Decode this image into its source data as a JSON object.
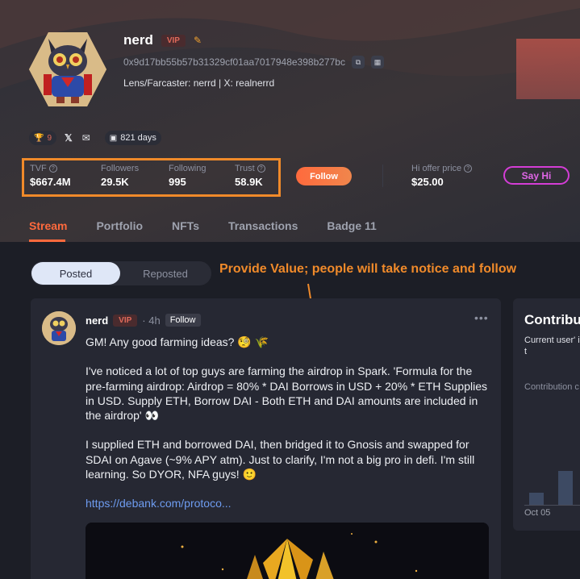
{
  "profile": {
    "name": "nerd",
    "vip_label": "VIP",
    "address": "0x9d17bb55b57b31329cf01aa7017948e398b277bc",
    "socials": "Lens/Farcaster: nerrd | X: realnerrd",
    "trophy_count": "9",
    "days": "821 days"
  },
  "stats": {
    "tvf_label": "TVF",
    "tvf_value": "$667.4M",
    "followers_label": "Followers",
    "followers_value": "29.5K",
    "following_label": "Following",
    "following_value": "995",
    "trust_label": "Trust",
    "trust_value": "58.9K"
  },
  "actions": {
    "follow_label": "Follow",
    "offer_label": "Hi offer price",
    "offer_value": "$25.00",
    "say_hi_label": "Say Hi"
  },
  "tabs": [
    "Stream",
    "Portfolio",
    "NFTs",
    "Transactions",
    "Badge 11"
  ],
  "toggle": {
    "posted": "Posted",
    "reposted": "Reposted"
  },
  "annotation": "Provide Value; people will take notice and follow",
  "post": {
    "author": "nerd",
    "vip_label": "VIP",
    "time": "· 4h",
    "follow_label": "Follow",
    "para1": "GM! Any good farming ideas? 🧐 🌾",
    "para2": "I've noticed a lot of top guys are farming the airdrop in Spark. 'Formula for the pre-farming airdrop: Airdrop = 80% * DAI Borrows in USD + 20% * ETH Supplies in USD. Supply ETH, Borrow DAI - Both ETH and DAI amounts are included in the airdrop' 👀",
    "para3": "I supplied ETH and borrowed DAI, then bridged it to Gnosis and swapped for SDAI on Agave (~9% APY atm). Just to clarify, I'm not a big pro in defi. I'm still learning. So DYOR, NFA guys! 🙂",
    "link": "https://debank.com/protoco..."
  },
  "contrib": {
    "title": "Contribu",
    "text": "Current user' is under testin occur at any t",
    "sub": "Contribution c",
    "date": "Oct 05"
  },
  "colors": {
    "accent": "#ff6a3d",
    "annotation": "#f08a2a",
    "say_hi": "#d43dd6",
    "link": "#6e9cf0"
  }
}
